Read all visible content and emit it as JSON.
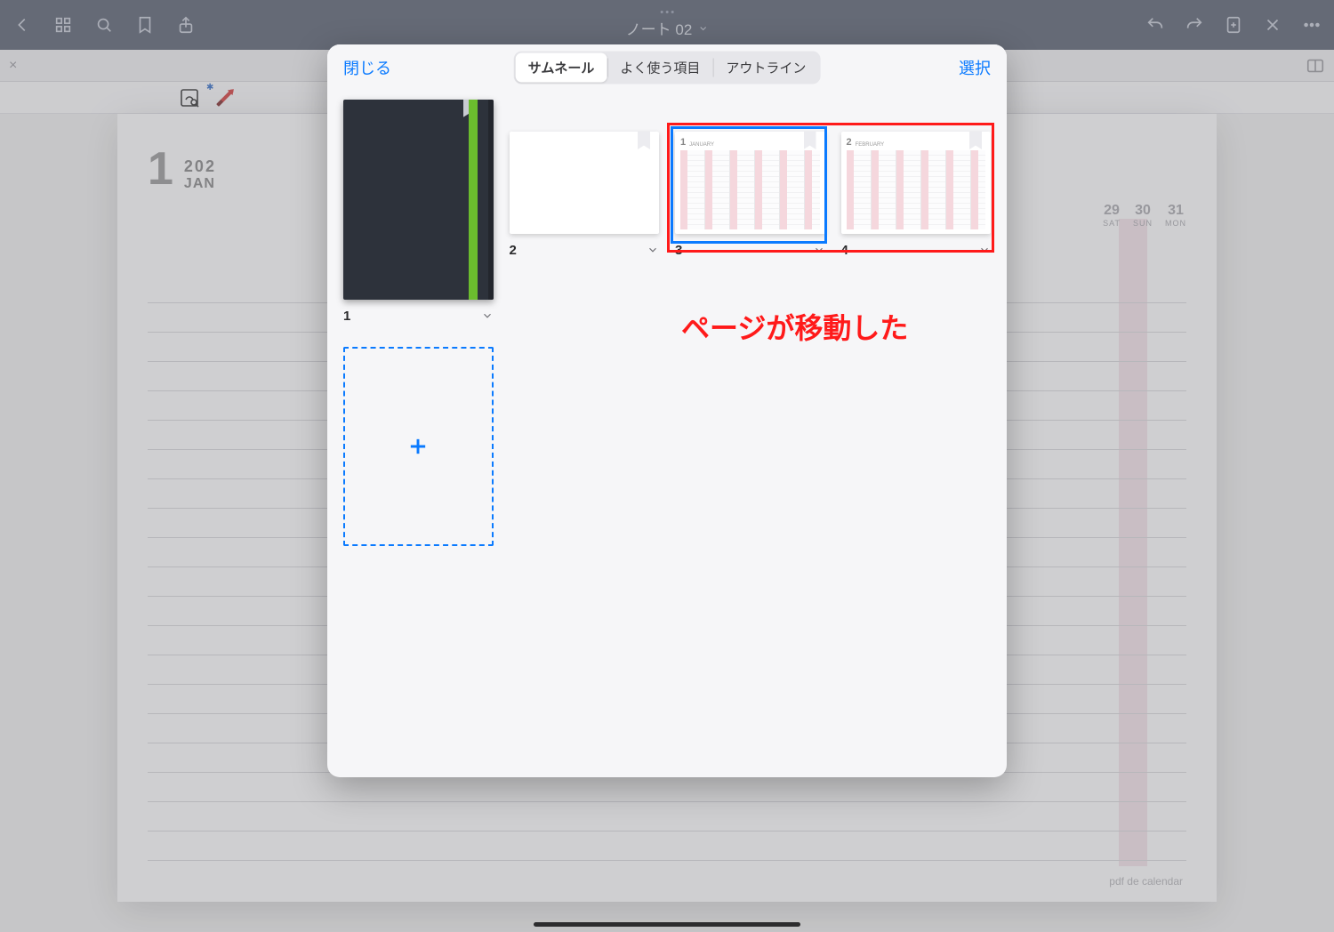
{
  "toolbar": {
    "document_title": "ノート 02"
  },
  "background_page": {
    "month_number": "1",
    "year": "202",
    "month_abbrev": "JAN",
    "footer_brand": "pdf de calendar",
    "right_days": [
      {
        "d": "29",
        "w": "SAT"
      },
      {
        "d": "30",
        "w": "SUN"
      },
      {
        "d": "31",
        "w": "MON"
      }
    ]
  },
  "modal": {
    "close_label": "閉じる",
    "select_label": "選択",
    "tabs": {
      "thumbnails": "サムネール",
      "favorites": "よく使う項目",
      "outline": "アウトライン"
    },
    "pages": [
      {
        "number": "1",
        "type": "cover"
      },
      {
        "number": "2",
        "type": "blank_land"
      },
      {
        "number": "3",
        "type": "month_land",
        "month_num": "1",
        "month_label": "JANUARY",
        "selected": true
      },
      {
        "number": "4",
        "type": "month_land",
        "month_num": "2",
        "month_label": "FEBRUARY"
      }
    ],
    "annotation_text": "ページが移動した"
  }
}
